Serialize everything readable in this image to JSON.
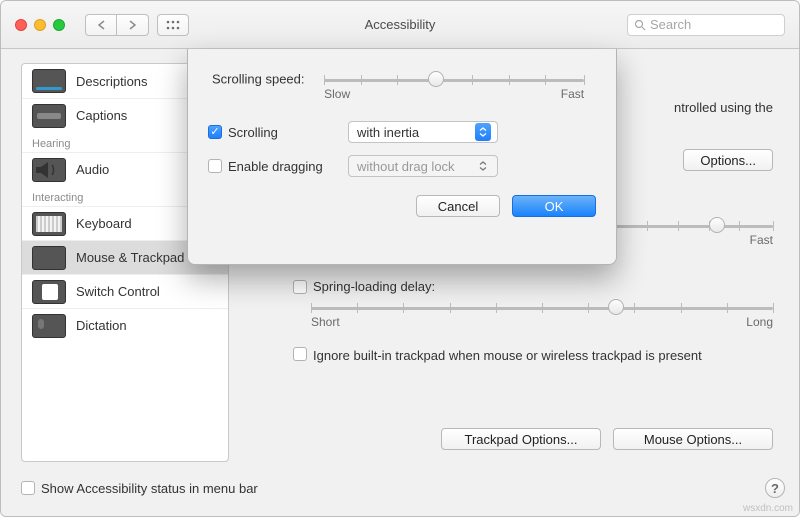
{
  "window": {
    "title": "Accessibility"
  },
  "toolbar": {
    "search_placeholder": "Search"
  },
  "sidebar": {
    "items": [
      {
        "label": "Descriptions"
      },
      {
        "label": "Captions"
      }
    ],
    "hearing_label": "Hearing",
    "hearing_items": [
      {
        "label": "Audio"
      }
    ],
    "interacting_label": "Interacting",
    "interacting_items": [
      {
        "label": "Keyboard"
      },
      {
        "label": "Mouse & Trackpad"
      },
      {
        "label": "Switch Control"
      },
      {
        "label": "Dictation"
      }
    ]
  },
  "content": {
    "partial_text": "ntrolled using the",
    "options_label": "Options...",
    "fast_label": "Fast",
    "spring_label": "Spring-loading delay:",
    "spring_short": "Short",
    "spring_long": "Long",
    "ignore_label": "Ignore built-in trackpad when mouse or wireless trackpad is present",
    "trackpad_btn": "Trackpad Options...",
    "mouse_btn": "Mouse Options..."
  },
  "sheet": {
    "speed_label": "Scrolling speed:",
    "slow": "Slow",
    "fast": "Fast",
    "scrolling_label": "Scrolling",
    "scrolling_value": "with inertia",
    "dragging_label": "Enable dragging",
    "dragging_value": "without drag lock",
    "cancel": "Cancel",
    "ok": "OK"
  },
  "footer": {
    "show_status": "Show Accessibility status in menu bar"
  },
  "watermark": "wsxdn.com"
}
